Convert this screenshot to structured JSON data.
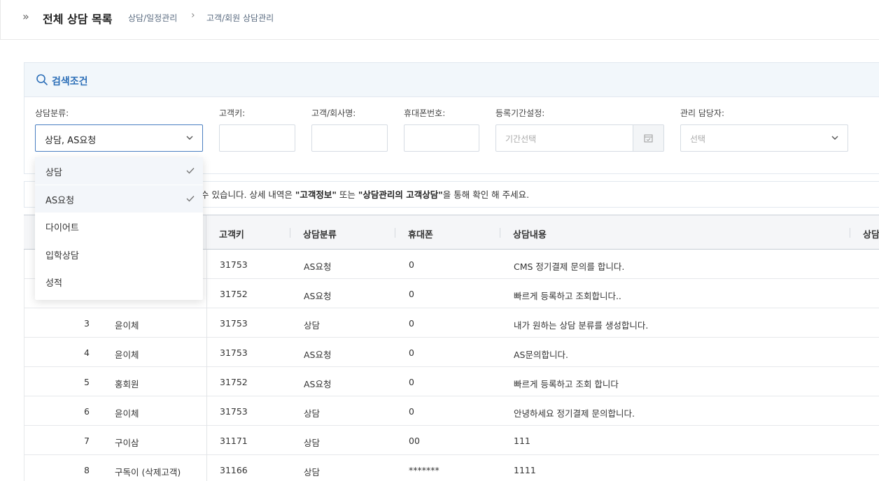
{
  "header": {
    "title": "전체 상담 목록",
    "breadcrumb": [
      "상담/일정관리",
      "고객/회원 상담관리"
    ]
  },
  "search": {
    "title": "검색조건",
    "fields": {
      "category": {
        "label": "상담분류:",
        "value": "상담, AS요청"
      },
      "customer_key": {
        "label": "고객키:",
        "value": ""
      },
      "company_name": {
        "label": "고객/회사명:",
        "value": ""
      },
      "phone": {
        "label": "휴대폰번호:",
        "value": ""
      },
      "period": {
        "label": "등록기간설정:",
        "placeholder": "기간선택"
      },
      "manager": {
        "label": "관리 담당자:",
        "placeholder": "선택"
      }
    }
  },
  "dropdown": {
    "options": [
      {
        "label": "상담",
        "selected": true
      },
      {
        "label": "AS요청",
        "selected": true
      },
      {
        "label": "다이어트",
        "selected": false
      },
      {
        "label": "입학상담",
        "selected": false
      },
      {
        "label": "성적",
        "selected": false
      }
    ]
  },
  "info": {
    "prefix": "수 있습니다. 상세 내역은 ",
    "bold1": "\"고객정보\"",
    "mid": " 또는 ",
    "bold2": "\"상담관리의 고객상담\"",
    "suffix": "을 통해 확인 해 주세요."
  },
  "table": {
    "headers": {
      "customer_key": "고객키",
      "category": "상담분류",
      "phone": "휴대폰",
      "content": "상담내용",
      "extra": "상담"
    },
    "rows": [
      {
        "no": "",
        "name": "",
        "key": "31753",
        "cat": "AS요청",
        "phone": "0",
        "content": "CMS 정기결제 문의를 합니다."
      },
      {
        "no": "",
        "name": "",
        "key": "31752",
        "cat": "AS요청",
        "phone": "0",
        "content": "빠르게 등록하고 조회합니다.."
      },
      {
        "no": "3",
        "name": "윤이체",
        "key": "31753",
        "cat": "상담",
        "phone": "0",
        "content": "내가 원하는 상담 분류를 생성합니다."
      },
      {
        "no": "4",
        "name": "윤이체",
        "key": "31753",
        "cat": "AS요청",
        "phone": "0",
        "content": "AS문의합니다."
      },
      {
        "no": "5",
        "name": "홍회원",
        "key": "31752",
        "cat": "AS요청",
        "phone": "0",
        "content": "빠르게 등록하고 조회 합니다"
      },
      {
        "no": "6",
        "name": "윤이체",
        "key": "31753",
        "cat": "상담",
        "phone": "0",
        "content": "안녕하세요 정기결제 문의합니다."
      },
      {
        "no": "7",
        "name": "구이삼",
        "key": "31171",
        "cat": "상담",
        "phone": "00",
        "content": "111"
      },
      {
        "no": "8",
        "name": "구독이 (삭제고객)",
        "key": "31166",
        "cat": "상담",
        "phone": "*******",
        "content": "1111"
      }
    ]
  },
  "colors": {
    "accent": "#2d6fb8",
    "panel_bg": "#f2f7fb",
    "select_border": "#4a7fc1"
  },
  "icons": [
    "double-chevron-icon",
    "chevron-right-icon",
    "search-icon",
    "chevron-down-icon",
    "calendar-icon",
    "check-icon"
  ]
}
